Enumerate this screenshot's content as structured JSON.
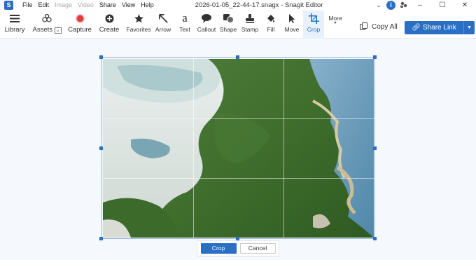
{
  "window": {
    "app_initial": "S",
    "title": "2026-01-05_22-44-17.snagx - Snagit Editor",
    "menu": [
      {
        "label": "File",
        "enabled": true
      },
      {
        "label": "Edit",
        "enabled": true
      },
      {
        "label": "Image",
        "enabled": false
      },
      {
        "label": "Video",
        "enabled": false
      },
      {
        "label": "Share",
        "enabled": true
      },
      {
        "label": "View",
        "enabled": true
      },
      {
        "label": "Help",
        "enabled": true
      }
    ],
    "info_badge": "i"
  },
  "toolbar": {
    "library": "Library",
    "assets": "Assets",
    "capture": "Capture",
    "create": "Create",
    "tools": [
      {
        "label": "Favorites",
        "icon": "star-icon"
      },
      {
        "label": "Arrow",
        "icon": "arrow-icon"
      },
      {
        "label": "Text",
        "icon": "text-icon"
      },
      {
        "label": "Callout",
        "icon": "callout-icon"
      },
      {
        "label": "Shape",
        "icon": "shape-icon"
      },
      {
        "label": "Stamp",
        "icon": "stamp-icon"
      },
      {
        "label": "Fill",
        "icon": "fill-icon"
      },
      {
        "label": "Move",
        "icon": "move-icon"
      },
      {
        "label": "Crop",
        "icon": "crop-icon"
      }
    ],
    "active_tool": "Crop",
    "more": "More",
    "copy_all": "Copy All",
    "share_link": "Share Link"
  },
  "crop_actions": {
    "crop": "Crop",
    "cancel": "Cancel"
  },
  "colors": {
    "accent": "#2a6fc4",
    "canvas_bg": "#f5f8fc"
  }
}
